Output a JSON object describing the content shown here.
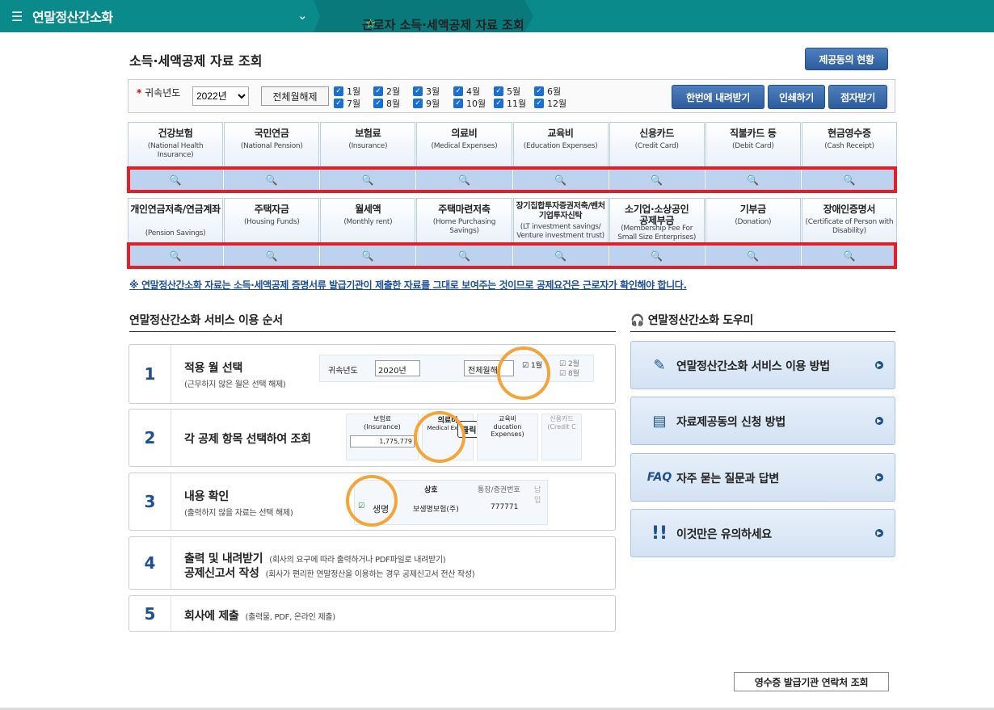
{
  "topbar": {
    "menu_icon": "hamburger-icon",
    "app_name": "연말정산간소화",
    "breadcrumb": "근로자 소득·세액공제 자료 조회",
    "star": "☆"
  },
  "page": {
    "title": "소득·세액공제 자료 조회",
    "provider_status_button": "제공동의 현황"
  },
  "filter": {
    "year_label": "귀속년도",
    "required_mark": "*",
    "year_value": "2022년",
    "clear_all": "전체월해제",
    "months": [
      "1월",
      "2월",
      "3월",
      "4월",
      "5월",
      "6월",
      "7월",
      "8월",
      "9월",
      "10월",
      "11월",
      "12월"
    ],
    "download_all": "한번에 내려받기",
    "print": "인쇄하기",
    "braille": "점자받기"
  },
  "row1": [
    {
      "title": "건강보험",
      "sub": "(National Health Insurance)"
    },
    {
      "title": "국민연금",
      "sub": "(National Pension)"
    },
    {
      "title": "보험료",
      "sub": "(Insurance)"
    },
    {
      "title": "의료비",
      "sub": "(Medical Expenses)"
    },
    {
      "title": "교육비",
      "sub": "(Education Expenses)"
    },
    {
      "title": "신용카드",
      "sub": "(Credit Card)"
    },
    {
      "title": "직불카드 등",
      "sub": "(Debit Card)"
    },
    {
      "title": "현금영수증",
      "sub": "(Cash Receipt)"
    }
  ],
  "row2": [
    {
      "title": "개인연금저축/연금계좌",
      "sub": "(Pension Savings)"
    },
    {
      "title": "주택자금",
      "sub": "(Housing Funds)"
    },
    {
      "title": "월세액",
      "sub": "(Monthly rent)"
    },
    {
      "title": "주택마련저축",
      "sub": "(Home Purchasing Savings)"
    },
    {
      "title": "장기집합투자증권저축/벤처기업투자신탁",
      "sub": "(LT investment savings/ Venture investment trust)"
    },
    {
      "title": "소기업·소상공인 공제부금",
      "sub": "(Membership Fee For Small Size Enterprises)"
    },
    {
      "title": "기부금",
      "sub": "(Donation)"
    },
    {
      "title": "장애인증명서",
      "sub": "(Certificate of Person with Disability)"
    }
  ],
  "notice": "※ 연말정산간소화 자료는 소득·세액공제 증명서류 발급기관이 제출한 자료를 그대로 보여주는 것이므로 공제요건은 근로자가 확인해야 합니다.",
  "steps_title": "연말정산간소화 서비스 이용 순서",
  "steps": [
    {
      "num": "1",
      "title": "적용 월 선택",
      "sub": "(근무하지 않은 월은 선택 해제)"
    },
    {
      "num": "2",
      "title": "각 공제 항목 선택하여 조회",
      "sub": ""
    },
    {
      "num": "3",
      "title": "내용 확인",
      "sub": "(출력하지 않을 자료는 선택 해제)"
    },
    {
      "num": "4",
      "title": "출력 및 내려받기",
      "sub": "(회사의 요구에 따라 출력하거나 PDF파일로 내려받기)",
      "title2": "공제신고서 작성",
      "sub2": "(회사가 편리한 연말정산을 이용하는 경우 공제신고서 전산 작성)"
    },
    {
      "num": "5",
      "title": "회사에 제출",
      "sub": "(출력물, PDF, 온라인 제출)"
    }
  ],
  "preview1": {
    "year_label": "귀속년도",
    "year": "2020년",
    "clear": "전체월해",
    "m1": "1월",
    "m2": "2월",
    "m8": "8월"
  },
  "preview2": {
    "c1": "보험료",
    "c1s": "(Insurance)",
    "c1v": "1,775,779",
    "c2": "의료비",
    "c2s": "Medical Expen",
    "click": "클릭!",
    "c3": "교육비",
    "c3s": "ducation Expenses)",
    "c4": "신용카드",
    "c4s": "(Credit C"
  },
  "preview3": {
    "h1": "상호",
    "h2": "통장/증권번호",
    "h3": "납입",
    "r1": "생명",
    "r1b": "보생명보험(주)",
    "r1c": "777771"
  },
  "help_title": "연말정산간소화 도우미",
  "help": [
    {
      "icon": "document-pen-icon",
      "label": "연말정산간소화 서비스 이용 방법"
    },
    {
      "icon": "form-icon",
      "label": "자료제공동의 신청 방법"
    },
    {
      "icon": "faq-icon",
      "label": "자주 묻는 질문과 답변",
      "prefix": "FAQ"
    },
    {
      "icon": "exclamation-icon",
      "label": "이것만은 유의하세요"
    }
  ],
  "contact_button": "영수증 발급기관 연락처 조회"
}
